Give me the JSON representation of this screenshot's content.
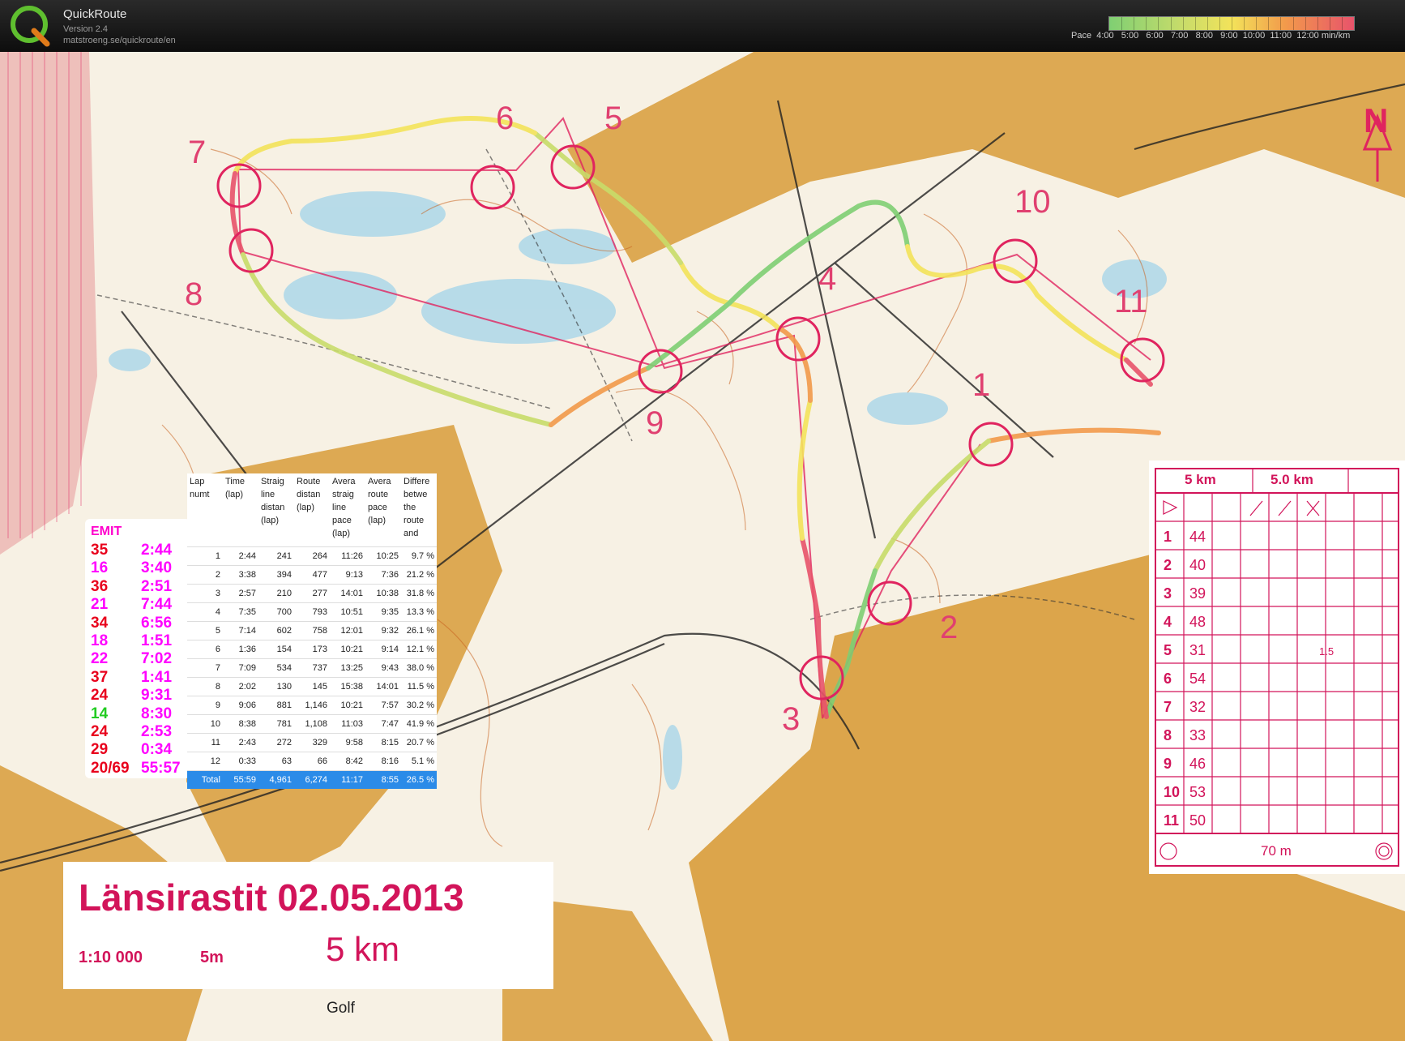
{
  "header": {
    "app_name": "QuickRoute",
    "version": "Version 2.4",
    "url": "matstroeng.se/quickroute/en",
    "pace_label": "Pace",
    "pace_ticks": [
      "4:00",
      "5:00",
      "6:00",
      "7:00",
      "8:00",
      "9:00",
      "10:00",
      "11:00",
      "12:00"
    ],
    "pace_unit": "min/km",
    "colors": {
      "fast": "#7fcf73",
      "mid": "#f3e35a",
      "slow": "#e8536b"
    }
  },
  "map": {
    "title": "Länsirastit 02.05.2013",
    "scale": "1:10 000",
    "contour": "5m",
    "distance": "5 km",
    "golf": "Golf",
    "north": "N",
    "control_labels": [
      "1",
      "2",
      "3",
      "4",
      "5",
      "6",
      "7",
      "8",
      "9",
      "10",
      "11"
    ]
  },
  "emit": {
    "title": "EMIT",
    "rows": [
      {
        "code": "35",
        "time": "2:44",
        "color": "#e8001c"
      },
      {
        "code": "16",
        "time": "3:40",
        "color": "#ff00ff"
      },
      {
        "code": "36",
        "time": "2:51",
        "color": "#e8001c"
      },
      {
        "code": "21",
        "time": "7:44",
        "color": "#ff00ff"
      },
      {
        "code": "34",
        "time": "6:56",
        "color": "#e8001c"
      },
      {
        "code": "18",
        "time": "1:51",
        "color": "#ff00ff"
      },
      {
        "code": "22",
        "time": "7:02",
        "color": "#ff00ff"
      },
      {
        "code": "37",
        "time": "1:41",
        "color": "#e8001c"
      },
      {
        "code": "24",
        "time": "9:31",
        "color": "#e8001c"
      },
      {
        "code": "14",
        "time": "8:30",
        "color": "#22cc22"
      },
      {
        "code": "24",
        "time": "2:53",
        "color": "#e8001c"
      },
      {
        "code": "29",
        "time": "0:34",
        "color": "#e8001c"
      },
      {
        "code": "20/69",
        "time": "55:57",
        "color": "#e8001c"
      }
    ]
  },
  "lap_table": {
    "headers": [
      "Lap numt",
      "Time (lap)",
      "Straig line distan (lap)",
      "Route distan (lap)",
      "Avera straig line pace (lap)",
      "Avera route pace (lap)",
      "Differe betwe the route and"
    ],
    "rows": [
      [
        "1",
        "2:44",
        "241",
        "264",
        "11:26",
        "10:25",
        "9.7 %"
      ],
      [
        "2",
        "3:38",
        "394",
        "477",
        "9:13",
        "7:36",
        "21.2 %"
      ],
      [
        "3",
        "2:57",
        "210",
        "277",
        "14:01",
        "10:38",
        "31.8 %"
      ],
      [
        "4",
        "7:35",
        "700",
        "793",
        "10:51",
        "9:35",
        "13.3 %"
      ],
      [
        "5",
        "7:14",
        "602",
        "758",
        "12:01",
        "9:32",
        "26.1 %"
      ],
      [
        "6",
        "1:36",
        "154",
        "173",
        "10:21",
        "9:14",
        "12.1 %"
      ],
      [
        "7",
        "7:09",
        "534",
        "737",
        "13:25",
        "9:43",
        "38.0 %"
      ],
      [
        "8",
        "2:02",
        "130",
        "145",
        "15:38",
        "14:01",
        "11.5 %"
      ],
      [
        "9",
        "9:06",
        "881",
        "1,146",
        "10:21",
        "7:57",
        "30.2 %"
      ],
      [
        "10",
        "8:38",
        "781",
        "1,108",
        "11:03",
        "7:47",
        "41.9 %"
      ],
      [
        "11",
        "2:43",
        "272",
        "329",
        "9:58",
        "8:15",
        "20.7 %"
      ],
      [
        "12",
        "0:33",
        "63",
        "66",
        "8:42",
        "8:16",
        "5.1 %"
      ]
    ],
    "total": [
      "Total",
      "55:59",
      "4,961",
      "6,274",
      "11:17",
      "8:55",
      "26.5 %"
    ]
  },
  "descriptions": {
    "header_left": "5 km",
    "header_right": "5.0 km",
    "rows": [
      {
        "n": "1",
        "code": "44"
      },
      {
        "n": "2",
        "code": "40"
      },
      {
        "n": "3",
        "code": "39"
      },
      {
        "n": "4",
        "code": "48"
      },
      {
        "n": "5",
        "code": "31",
        "extra": "1.5"
      },
      {
        "n": "6",
        "code": "54"
      },
      {
        "n": "7",
        "code": "32"
      },
      {
        "n": "8",
        "code": "33"
      },
      {
        "n": "9",
        "code": "46"
      },
      {
        "n": "10",
        "code": "53"
      },
      {
        "n": "11",
        "code": "50"
      }
    ],
    "finish": "70 m"
  }
}
